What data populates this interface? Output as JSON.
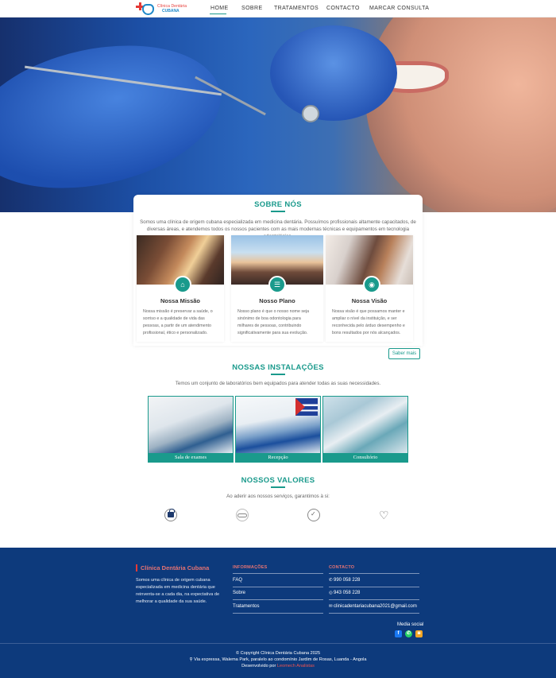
{
  "brand": {
    "line1": "Clínica Dentária",
    "line2": "CUBANA"
  },
  "nav": {
    "items": [
      {
        "label": "HOME",
        "active": true
      },
      {
        "label": "SOBRE"
      },
      {
        "label": "TRATAMENTOS"
      },
      {
        "label": "CONTACTO"
      },
      {
        "label": "MARCAR CONSULTA"
      }
    ]
  },
  "about": {
    "title": "SOBRE NÓS",
    "text": "Somos uma clínica de origem cubana especializada em medicina dentária. Possuímos profissionais altamente capacitados, de diversas áreas, e atendemos todos os nossos pacientes com as mais modernas técnicas e equipamentos em tecnologia odontológica.",
    "cards": [
      {
        "title": "Nossa Missão",
        "icon": "house-heart-icon",
        "text": "Nossa missão é preservar a saúde, o sorriso e a qualidade de vida das pessoas, a partir de um atendimento profissional, ético e personalizado."
      },
      {
        "title": "Nosso Plano",
        "icon": "clipboard-icon",
        "text": "Nosso plano é que o nosso nome seja sinónimo de boa odontologia para milhares de pessoas, contribuindo significativamente para sua evolução."
      },
      {
        "title": "Nossa Visão",
        "icon": "eye-icon",
        "text": "Nossa visão é que possamos manter e ampliar o nível da instituição, e ser reconhecida pelo árduo desempenho e bons resultados por nós alcançados."
      }
    ],
    "more_label": "Saber mais"
  },
  "installations": {
    "title": "NOSSAS INSTALAÇÕES",
    "subtitle": "Temos um conjunto de laboratórios bem equipados para atender todas as suas necessidades.",
    "items": [
      {
        "caption": "Sala de exames"
      },
      {
        "caption": "Recepção"
      },
      {
        "caption": "Consultório"
      }
    ]
  },
  "values": {
    "title": "NOSSOS VALORES",
    "subtitle": "Ao aderir aos nossos serviços, garantimos à si:",
    "icons": [
      "lock-icon",
      "hand-care-icon",
      "medal-icon",
      "handshake-heart-icon"
    ]
  },
  "footer": {
    "brand": "Clínica Dentária Cubana",
    "description": "Somos uma clínica de origem cubana especializada em medicina dentária que reinventa-se a cada dia, na expectativa de melhorar a qualidade da sua saúde.",
    "info_heading": "INFORMAÇÕES",
    "info_links": [
      "FAQ",
      "Sobre",
      "Tratamentos"
    ],
    "contact_heading": "CONTACTO",
    "phone1": "990 058 228",
    "phone2": "943 058 228",
    "email": "clinicadentariacubana2021@gmail.com",
    "media_label": "Media social",
    "copyright": "© Copyright Clínica Dentária Cubana 2025",
    "address": "Via expressa, Walema Park, paralelo ao condomínio Jardim de Rosas, Luanda - Angola",
    "developed_by": "Desenvolvido por",
    "developer": "Leomech Analistas"
  },
  "colors": {
    "accent": "#1a9a8c",
    "footer_bg": "#0d3a7c",
    "brand_red": "#e53935"
  }
}
